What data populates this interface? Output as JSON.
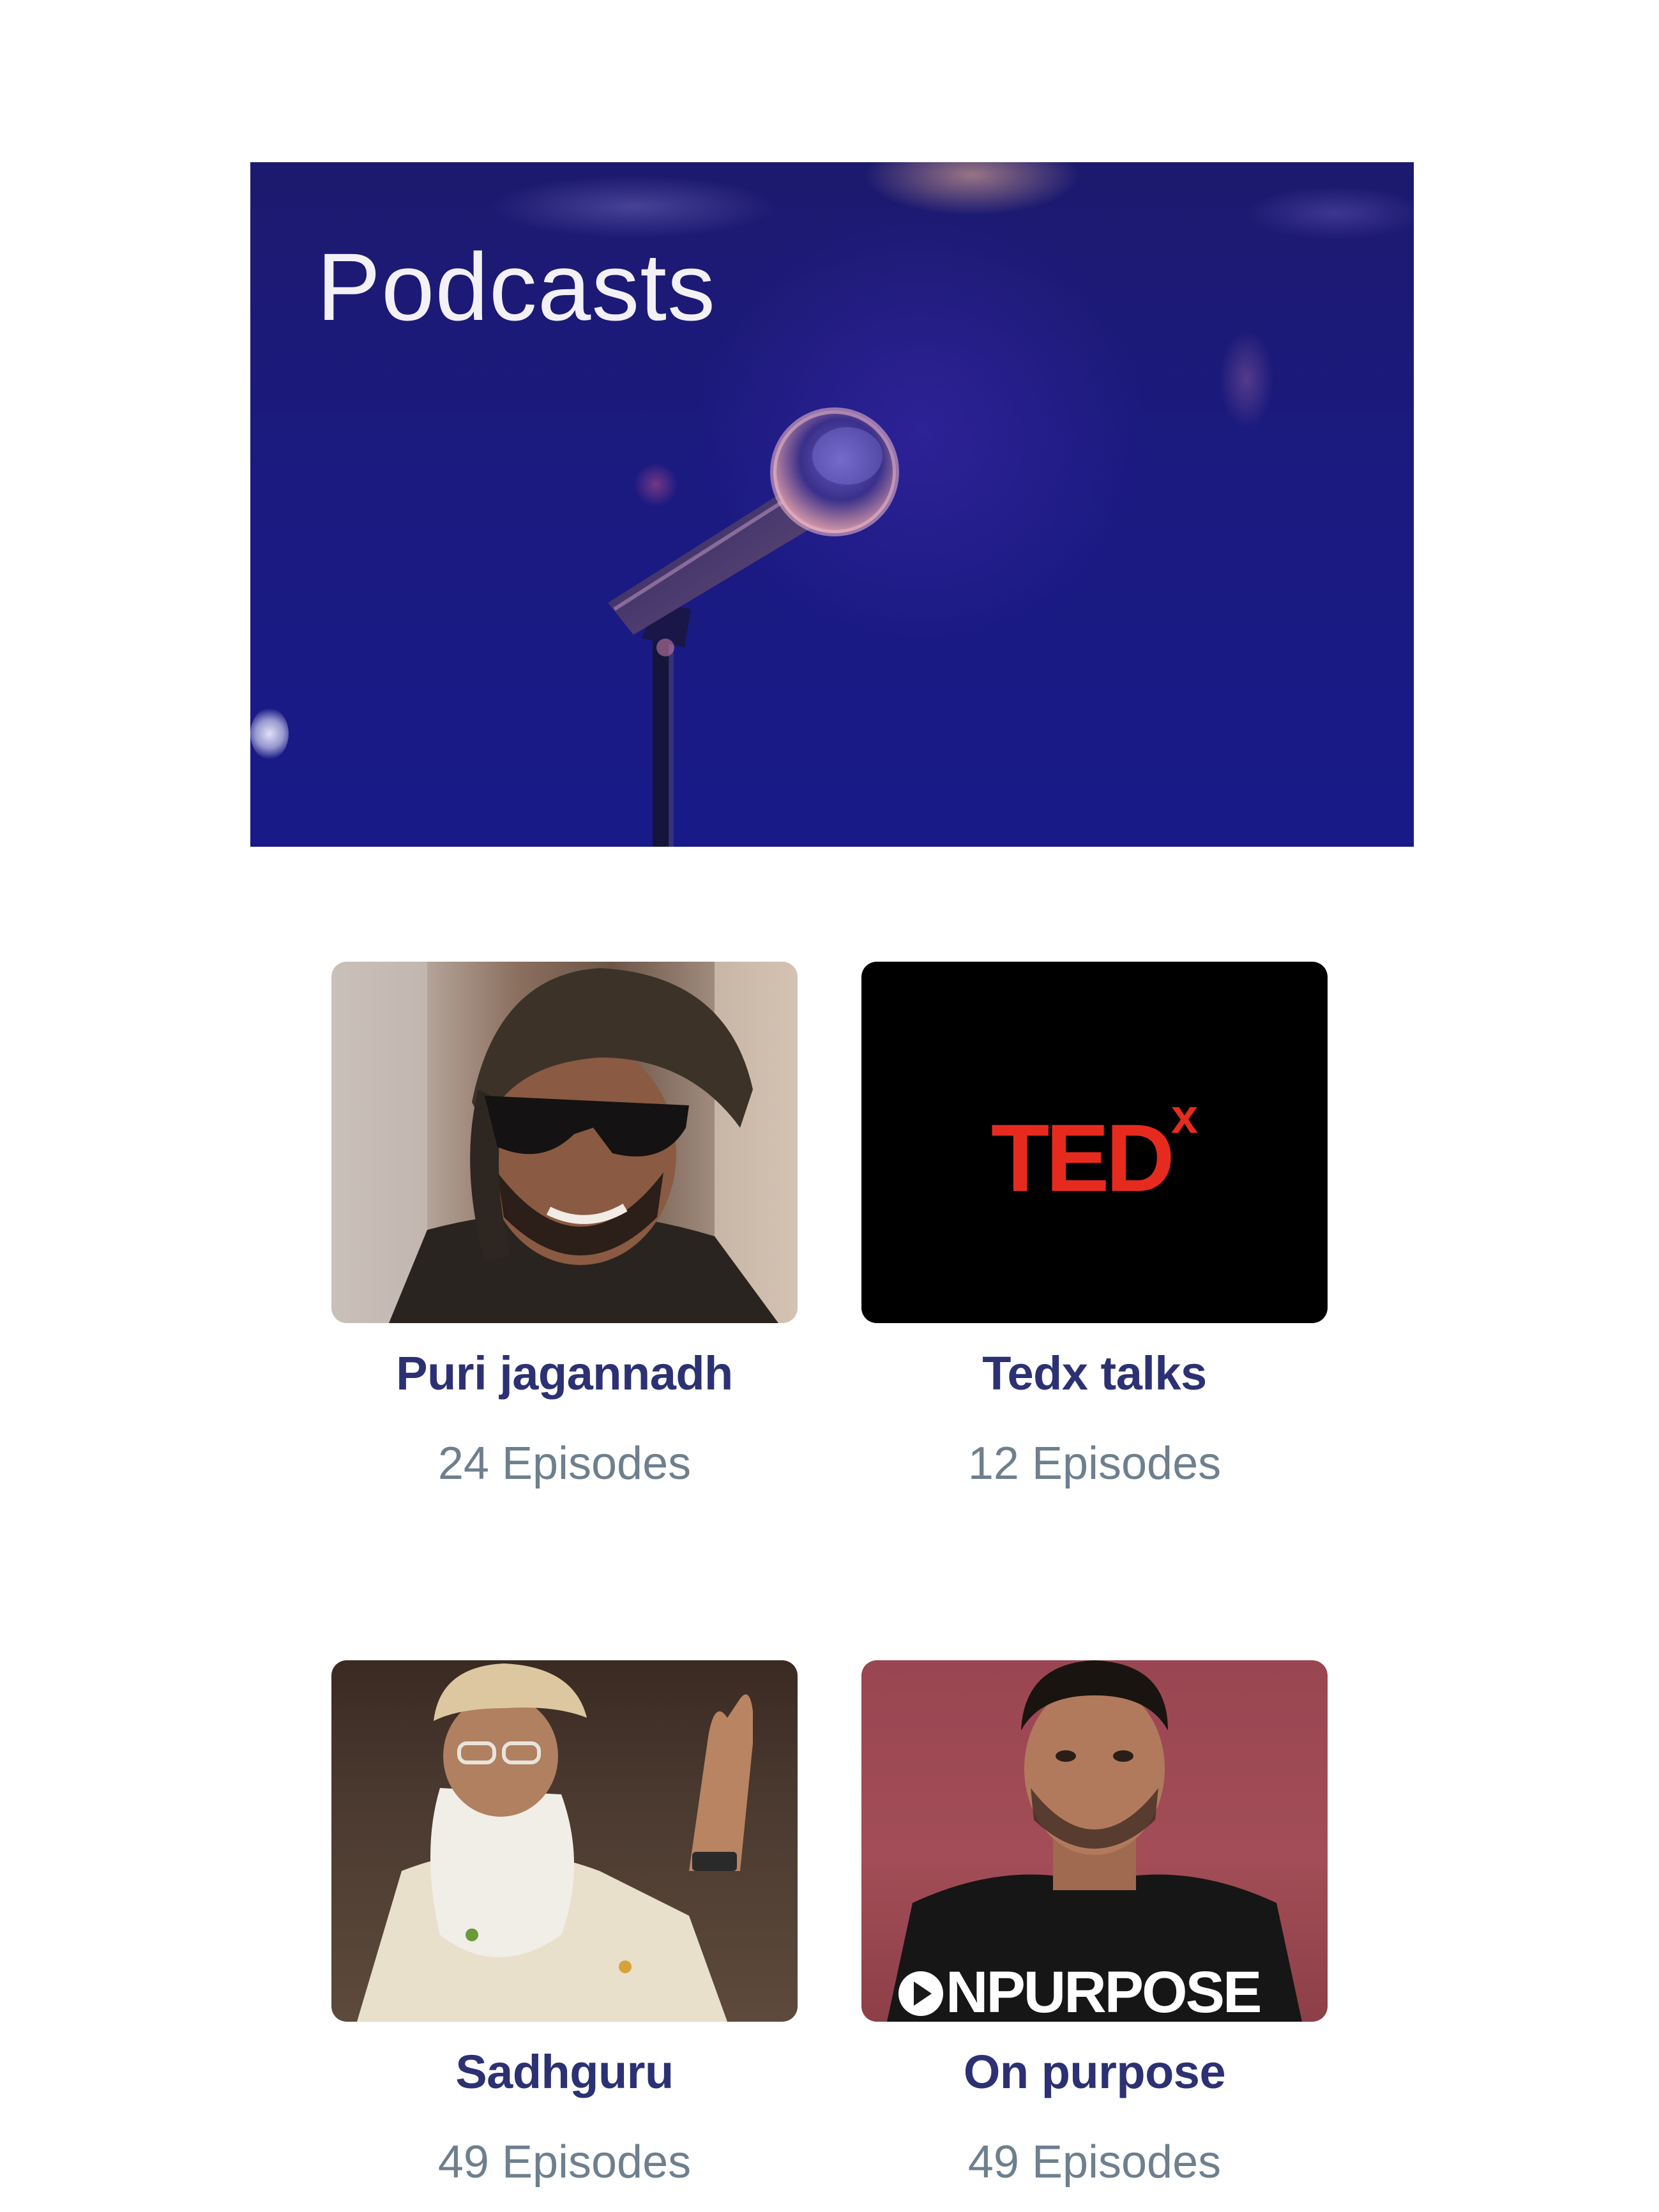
{
  "hero": {
    "title": "Podcasts",
    "image_icon": "microphone-icon"
  },
  "podcasts": [
    {
      "title": "Puri jagannadh",
      "episodes": "24 Episodes",
      "thumbnail": "portrait-headscarf-sunglasses"
    },
    {
      "title": "Tedx talks",
      "episodes": "12 Episodes",
      "thumbnail": "tedx-logo",
      "logo_text": "TED",
      "logo_sup": "x"
    },
    {
      "title": "Sadhguru",
      "episodes": "49 Episodes",
      "thumbnail": "portrait-white-beard"
    },
    {
      "title": "On purpose",
      "episodes": "49 Episodes",
      "thumbnail": "on-purpose-logo",
      "logo_text": "NPURPOSE"
    }
  ],
  "colors": {
    "hero_bg": "#1b1a80",
    "card_title": "#2c3173",
    "card_sub": "#6e7f8e",
    "ted_red": "#e62b1e",
    "on_purpose_bg": "#a24d57"
  }
}
